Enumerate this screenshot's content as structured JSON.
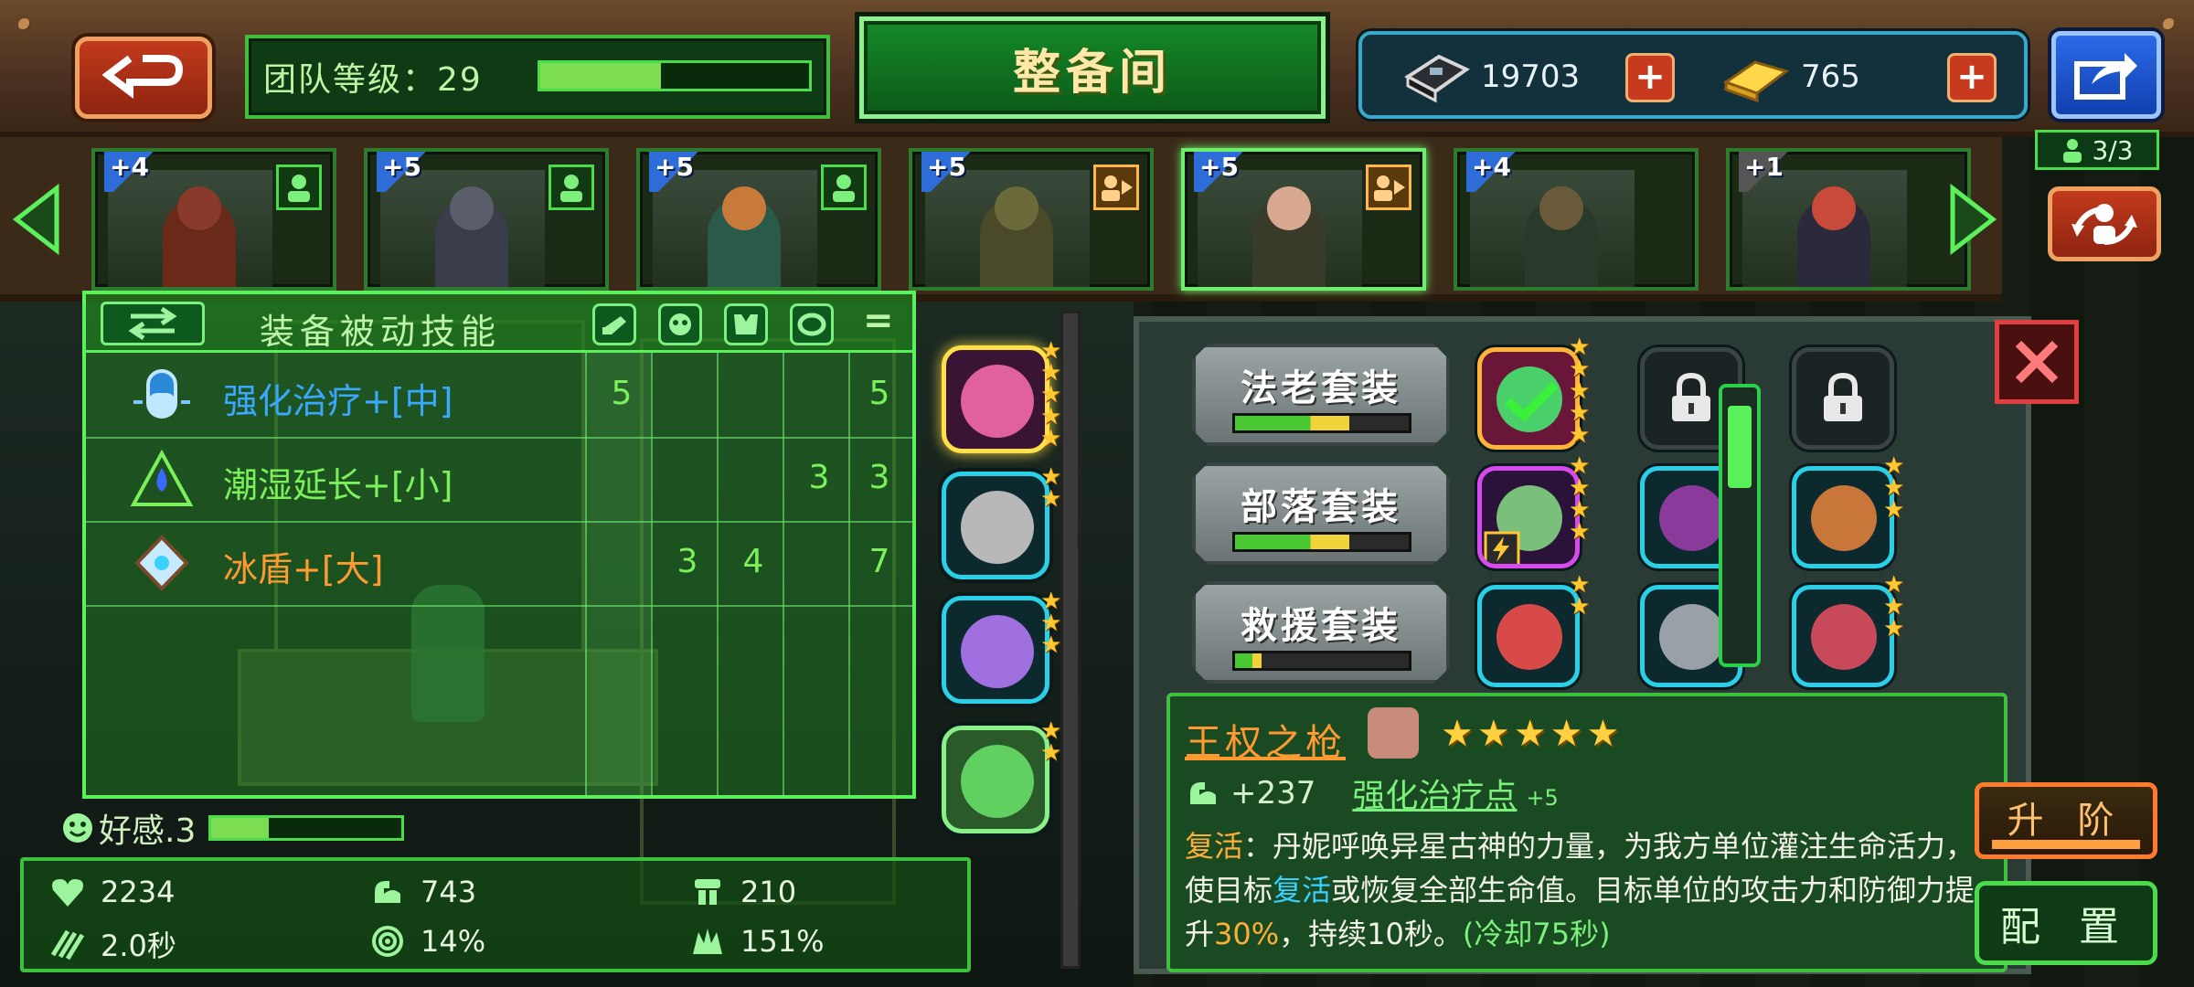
{
  "header": {
    "team_level_label": "团队等级：29",
    "team_level_progress": 0.45,
    "title": "整备间",
    "currencies": [
      {
        "icon": "chip-currency-icon",
        "value": "19703"
      },
      {
        "icon": "gold-bar-icon",
        "value": "765"
      }
    ]
  },
  "heroes": [
    {
      "level": "+4",
      "tag": "profile",
      "active": false
    },
    {
      "level": "+5",
      "tag": "profile",
      "active": false
    },
    {
      "level": "+5",
      "tag": "profile",
      "active": false
    },
    {
      "level": "+5",
      "tag": "deployed",
      "active": false
    },
    {
      "level": "+5",
      "tag": "deployed",
      "active": true
    },
    {
      "level": "+4",
      "tag": "none",
      "active": false
    },
    {
      "level": "+1",
      "tag": "none",
      "active": false
    }
  ],
  "squad_count": "3/3",
  "passive_panel": {
    "title": "装备被动技能",
    "sum_symbol": "=",
    "column_icons": [
      "weapon-slot-icon",
      "helmet-slot-icon",
      "armor-slot-icon",
      "ring-slot-icon"
    ],
    "rows": [
      {
        "name": "强化治疗+[中]",
        "color": "#3aa8ff",
        "icon": "heal-capsule-icon",
        "values": [
          "5",
          "",
          "",
          ""
        ],
        "total": "5"
      },
      {
        "name": "潮湿延长+[小]",
        "color": "#7cf05a",
        "icon": "water-drop-icon",
        "values": [
          "",
          "",
          "",
          "3"
        ],
        "total": "3"
      },
      {
        "name": "冰盾+[大]",
        "color": "#ff9a32",
        "icon": "ice-shield-icon",
        "values": [
          "",
          "3",
          "4",
          ""
        ],
        "total": "7"
      }
    ]
  },
  "affinity_label": "好感.3",
  "stats": [
    {
      "icon": "heart-icon",
      "value": "2234"
    },
    {
      "icon": "attack-arm-icon",
      "value": "743"
    },
    {
      "icon": "defense-icon",
      "value": "210"
    },
    {
      "icon": "speed-icon",
      "value": "2.0秒"
    },
    {
      "icon": "target-icon",
      "value": "14%"
    },
    {
      "icon": "crit-icon",
      "value": "151%"
    }
  ],
  "equip_slots": [
    {
      "stars": 5,
      "style": "gold",
      "art": "#e060a0"
    },
    {
      "stars": 2,
      "style": "cyan",
      "art": "#b8b8b8"
    },
    {
      "stars": 3,
      "style": "cyan",
      "art": "#a070e0"
    },
    {
      "stars": 2,
      "style": "green",
      "art": "#60d060"
    }
  ],
  "sets": [
    {
      "name": "法老套装",
      "progress": 0.66
    },
    {
      "name": "部落套装",
      "progress": 0.66
    },
    {
      "name": "救援套装",
      "progress": 0.15
    }
  ],
  "weapon": {
    "name": "王权之枪",
    "stars": "★★★★★",
    "attack": "+237",
    "skill_link": "强化治疗点",
    "skill_plus": "+5",
    "desc_parts": [
      {
        "t": "复活",
        "c": "hl-orange"
      },
      {
        "t": "：丹妮呼唤异星古神的力量，为我方单位灌注生命活力，使目标",
        "c": ""
      },
      {
        "t": "复活",
        "c": "hl-blue"
      },
      {
        "t": "或恢复全部生命值。目标单位的攻击力和防御力提升",
        "c": ""
      },
      {
        "t": "30%",
        "c": "hl-orange"
      },
      {
        "t": "，持续10秒。",
        "c": ""
      },
      {
        "t": "(冷却75秒)",
        "c": "hl-green"
      }
    ]
  },
  "buttons": {
    "upgrade": "升 阶",
    "config": "配 置"
  },
  "colors": {
    "accent_green": "#4adc4a",
    "brown_frame": "#4a3020",
    "title_text": "#ffe8a8",
    "highlight_orange": "#ffae3a"
  }
}
